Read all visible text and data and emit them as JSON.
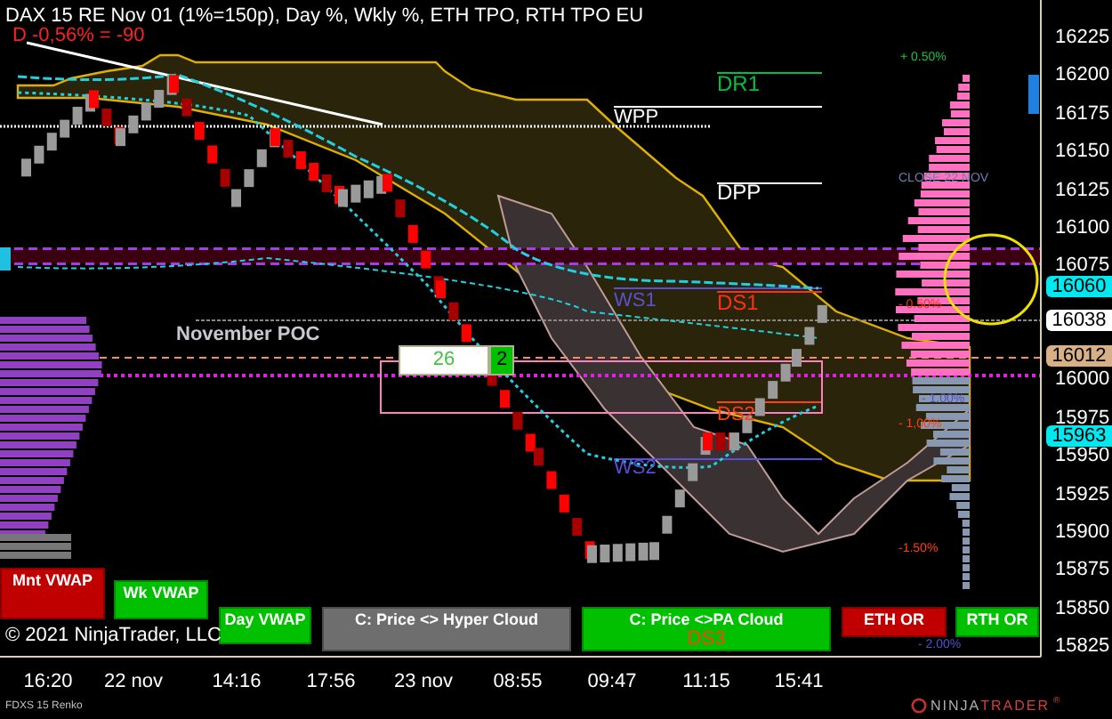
{
  "header": {
    "title": "DAX 15 RE Nov 01 (1%=150p), Day %, Wkly %, ETH TPO, RTH TPO EU",
    "day_change": "D -0,56% = -90"
  },
  "chart_labels": [
    {
      "text": "DR1",
      "color": "#00c040"
    },
    {
      "text": "WPP",
      "color": "#ffffff"
    },
    {
      "text": "DPP",
      "color": "#ffffff"
    },
    {
      "text": "WS1",
      "color": "#5a50d8"
    },
    {
      "text": "DS1",
      "color": "#ff3010"
    },
    {
      "text": "November POC",
      "color": "#c8c8d0"
    },
    {
      "text": "DS2",
      "color": "#ff4010"
    },
    {
      "text": "WS2",
      "color": "#5a50d8"
    },
    {
      "text": "+ 0.50%",
      "color": "#20c040"
    },
    {
      "text": "CLOSE 22 NOV",
      "color": "#7080b0"
    },
    {
      "text": "- 0.50%",
      "color": "#ff3010"
    },
    {
      "text": "- 1.00%",
      "color": "#5050d0"
    },
    {
      "text": "- 1,00%",
      "color": "#ff4010"
    },
    {
      "text": "-1.50%",
      "color": "#ff4010"
    },
    {
      "text": "- 2.00%",
      "color": "#5050d0"
    }
  ],
  "counter": {
    "value": "26",
    "count": "2"
  },
  "price_axis": {
    "ticks": [
      "16225",
      "16200",
      "16175",
      "16150",
      "16125",
      "16100",
      "16075",
      "16000",
      "15975",
      "15950",
      "15925",
      "15900",
      "15875",
      "15850",
      "15825"
    ]
  },
  "price_markers": [
    {
      "text": "16060",
      "color": "#00e8f0"
    },
    {
      "text": "16038",
      "color": "#ffffff"
    },
    {
      "text": "16012",
      "color": "#d8b088"
    },
    {
      "text": "15963",
      "color": "#00e8f0"
    }
  ],
  "time_axis": {
    "labels": [
      "16:20",
      "22 nov",
      "14:16",
      "17:56",
      "23 nov",
      "08:55",
      "09:47",
      "11:15",
      "15:41"
    ]
  },
  "buttons": [
    {
      "label": "Mnt VWAP",
      "color": "#c00000"
    },
    {
      "label": "Wk VWAP",
      "color": "#00c000"
    },
    {
      "label": "Day VWAP",
      "color": "#00c000"
    },
    {
      "label": "C: Price <> Hyper Cloud",
      "color": "#6e6e6e"
    },
    {
      "label": "C: Price <>PA Cloud",
      "color": "#00c000",
      "sublabel": "DS3"
    },
    {
      "label": "ETH OR",
      "color": "#c00000"
    },
    {
      "label": "RTH OR",
      "color": "#00c000"
    }
  ],
  "copyright": "© 2021 NinjaTrader, LLC",
  "instrument": "FDXS 15 Renko",
  "logo": {
    "first": "NINJA",
    "second": "TRADER",
    "mark": "®"
  }
}
